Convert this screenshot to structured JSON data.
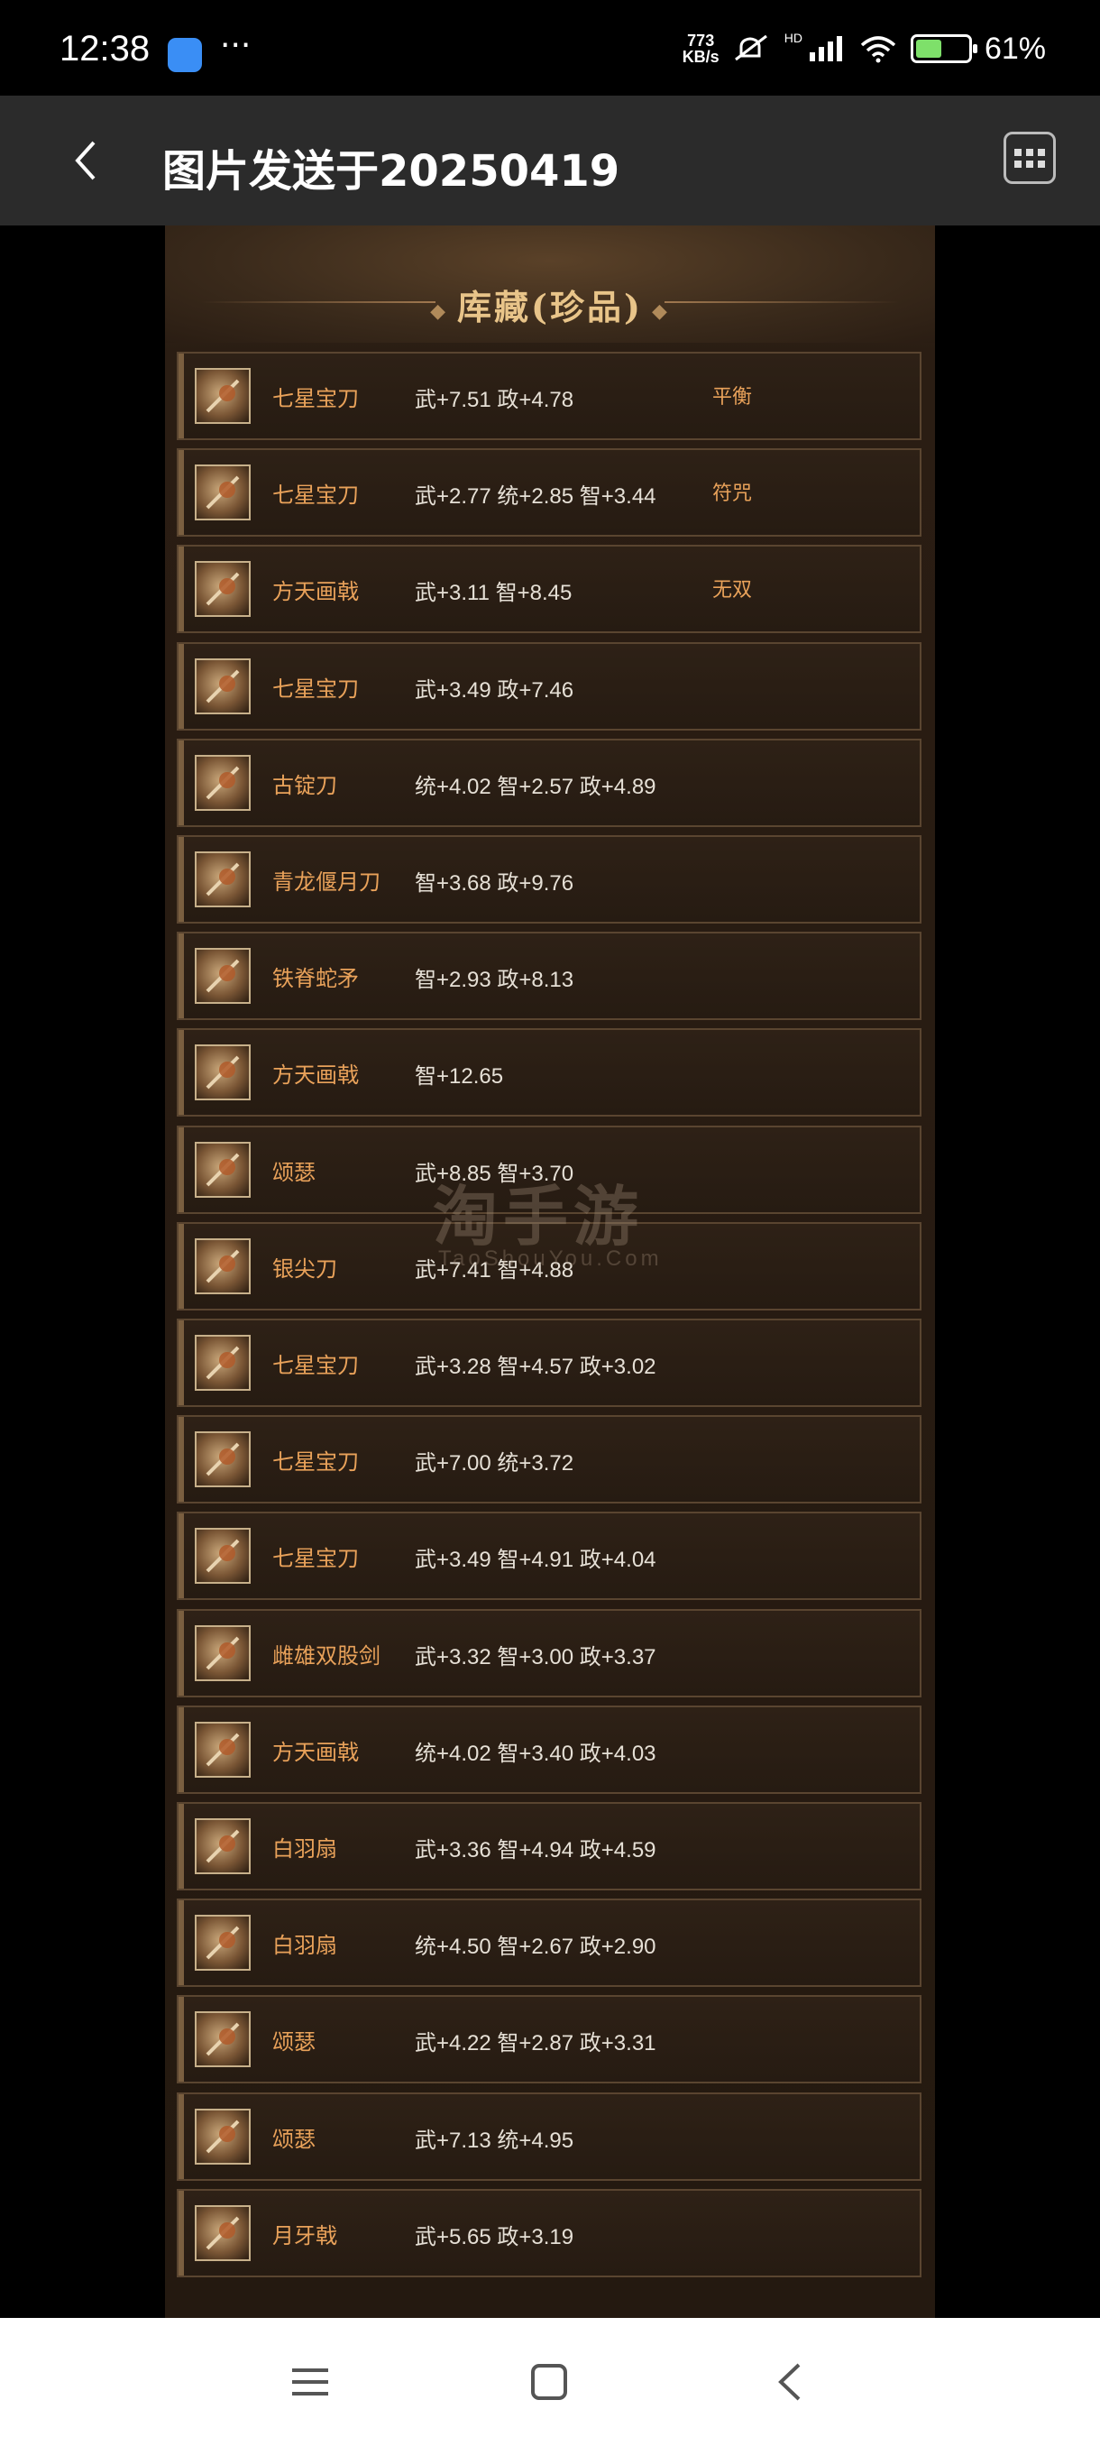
{
  "status_bar": {
    "time": "12:38",
    "dots": "···",
    "net_speed_value": "773",
    "net_speed_unit": "KB/s",
    "signal_label": "HD",
    "battery": "61%",
    "battery_level": 0.61
  },
  "header": {
    "title": "图片发送于20250419",
    "back_icon": "chevron-left-icon",
    "menu_icon": "grid-icon"
  },
  "panel": {
    "title": "库藏(珍品)",
    "items": [
      {
        "name": "七星宝刀",
        "stats": "武+7.51 政+4.78",
        "tag": "平衡"
      },
      {
        "name": "七星宝刀",
        "stats": "武+2.77 统+2.85 智+3.44",
        "tag": "符咒"
      },
      {
        "name": "方天画戟",
        "stats": "武+3.11 智+8.45",
        "tag": "无双"
      },
      {
        "name": "七星宝刀",
        "stats": "武+3.49 政+7.46",
        "tag": ""
      },
      {
        "name": "古锭刀",
        "stats": "统+4.02 智+2.57 政+4.89",
        "tag": ""
      },
      {
        "name": "青龙偃月刀",
        "stats": "智+3.68 政+9.76",
        "tag": ""
      },
      {
        "name": "铁脊蛇矛",
        "stats": "智+2.93 政+8.13",
        "tag": ""
      },
      {
        "name": "方天画戟",
        "stats": "智+12.65",
        "tag": ""
      },
      {
        "name": "颂瑟",
        "stats": "武+8.85 智+3.70",
        "tag": ""
      },
      {
        "name": "银尖刀",
        "stats": "武+7.41 智+4.88",
        "tag": ""
      },
      {
        "name": "七星宝刀",
        "stats": "武+3.28 智+4.57 政+3.02",
        "tag": ""
      },
      {
        "name": "七星宝刀",
        "stats": "武+7.00 统+3.72",
        "tag": ""
      },
      {
        "name": "七星宝刀",
        "stats": "武+3.49 智+4.91 政+4.04",
        "tag": ""
      },
      {
        "name": "雌雄双股剑",
        "stats": "武+3.32 智+3.00 政+3.37",
        "tag": ""
      },
      {
        "name": "方天画戟",
        "stats": "统+4.02 智+3.40 政+4.03",
        "tag": ""
      },
      {
        "name": "白羽扇",
        "stats": "武+3.36 智+4.94 政+4.59",
        "tag": ""
      },
      {
        "name": "白羽扇",
        "stats": "统+4.50 智+2.67 政+2.90",
        "tag": ""
      },
      {
        "name": "颂瑟",
        "stats": "武+4.22 智+2.87 政+3.31",
        "tag": ""
      },
      {
        "name": "颂瑟",
        "stats": "武+7.13 统+4.95",
        "tag": ""
      },
      {
        "name": "月牙戟",
        "stats": "武+5.65 政+3.19",
        "tag": ""
      }
    ]
  },
  "watermark": {
    "text": "淘手游",
    "sub": "TaoShouYou.Com"
  },
  "nav": {
    "menu_icon": "menu-icon",
    "home_icon": "home-icon",
    "back_icon": "back-icon"
  },
  "colors": {
    "item_name": "#e9a25a",
    "stats_text": "#e6e0d6",
    "panel_title": "#e8c489"
  }
}
